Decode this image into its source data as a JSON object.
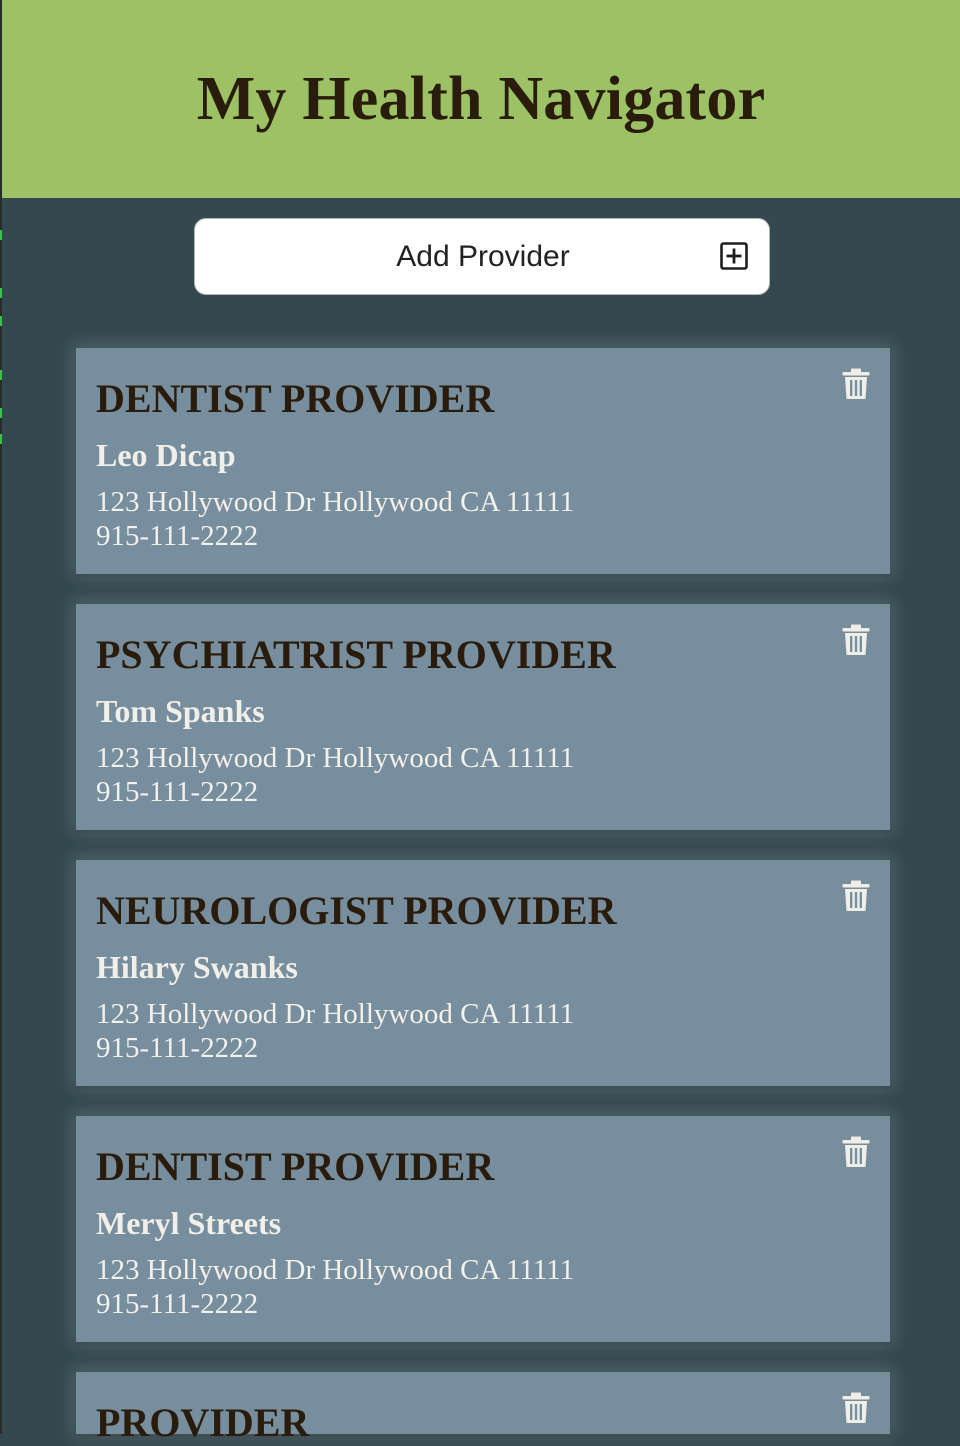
{
  "header": {
    "title": "My Health Navigator"
  },
  "toolbar": {
    "add_provider_label": "Add Provider",
    "add_icon": "plus-square-icon"
  },
  "providers": [
    {
      "type": "DENTIST PROVIDER",
      "name": "Leo Dicap",
      "address": "123 Hollywood Dr Hollywood CA 11111",
      "phone": "915-111-2222",
      "delete_icon": "trash-icon"
    },
    {
      "type": "PSYCHIATRIST PROVIDER",
      "name": "Tom Spanks",
      "address": "123 Hollywood Dr Hollywood CA 11111",
      "phone": "915-111-2222",
      "delete_icon": "trash-icon"
    },
    {
      "type": "NEUROLOGIST PROVIDER",
      "name": "Hilary Swanks",
      "address": "123 Hollywood Dr Hollywood CA 11111",
      "phone": "915-111-2222",
      "delete_icon": "trash-icon"
    },
    {
      "type": "DENTIST PROVIDER",
      "name": "Meryl Streets",
      "address": "123 Hollywood Dr Hollywood CA 11111",
      "phone": "915-111-2222",
      "delete_icon": "trash-icon"
    },
    {
      "type": "PROVIDER",
      "name": "",
      "address": "",
      "phone": "",
      "delete_icon": "trash-icon"
    }
  ],
  "colors": {
    "header_bg": "#9dc265",
    "page_bg": "#33494f",
    "card_bg": "#778e9e",
    "title_text": "#2a1c0c",
    "card_text_light": "#f4f1ea"
  }
}
